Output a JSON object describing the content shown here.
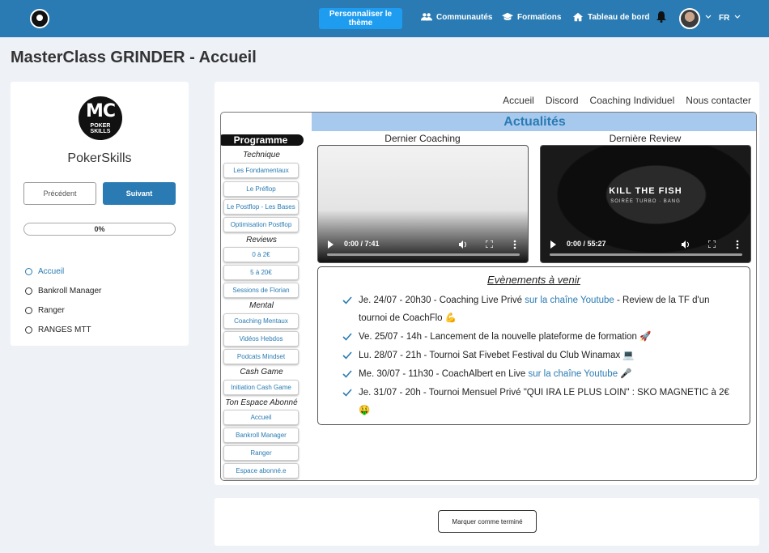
{
  "header": {
    "theme_button": "Personnaliser le thème",
    "nav": [
      {
        "label": "Communautés",
        "icon": "users-icon"
      },
      {
        "label": "Formations",
        "icon": "graduation-cap-icon"
      },
      {
        "label": "Tableau de bord",
        "icon": "home-icon"
      }
    ],
    "language": "FR",
    "brand_color": "#2a7bb3"
  },
  "page_title": "MasterClass GRINDER - Accueil",
  "course": {
    "logo_initials": "MC",
    "logo_line1": "POKER",
    "logo_line2": "SKILLS",
    "name": "PokerSkills",
    "prev_label": "Précédent",
    "next_label": "Suivant",
    "progress_label": "0%",
    "progress_value": 0,
    "lessons": [
      {
        "label": "Accueil",
        "active": true
      },
      {
        "label": "Bankroll Manager",
        "active": false
      },
      {
        "label": "Ranger",
        "active": false
      },
      {
        "label": "RANGES MTT",
        "active": false
      }
    ]
  },
  "main": {
    "top_links": [
      "Accueil",
      "Discord",
      "Coaching Individuel",
      "Nous contacter"
    ],
    "program_title": "Programme",
    "groups": [
      {
        "title": "Technique",
        "items": [
          "Les Fondamentaux",
          "Le Préflop",
          "Le Postflop - Les Bases",
          "Optimisation Postflop"
        ]
      },
      {
        "title": "Reviews",
        "items": [
          "0 à 2€",
          "5 à 20€",
          "Sessions de Florian"
        ]
      },
      {
        "title": "Mental",
        "items": [
          "Coaching Mentaux",
          "Vidéos Hebdos",
          "Podcats Mindset"
        ]
      },
      {
        "title": "Cash Game",
        "items": [
          "Initiation Cash Game"
        ]
      },
      {
        "title": "Ton Espace Abonné",
        "items": [
          "Accueil",
          "Bankroll Manager",
          "Ranger",
          "Espace abonné.e"
        ]
      }
    ],
    "news_title": "Actualités",
    "video1": {
      "label": "Dernier Coaching",
      "time": "0:00 / 7:41"
    },
    "video2": {
      "label": "Dernière Review",
      "time": "0:00 / 55:27",
      "overlay_title": "KILL THE FISH",
      "overlay_sub": "SOIRÉE TURBO · BANG"
    },
    "events_title": "Evènements à venir",
    "events": [
      {
        "before": "Je. 24/07 - 20h30 - Coaching Live Privé ",
        "link": "sur la chaîne Youtube",
        "after": " - Review de la TF d'un tournoi de CoachFlo 💪"
      },
      {
        "before": "Ve. 25/07 - 14h - Lancement de la nouvelle plateforme de formation 🚀",
        "link": "",
        "after": ""
      },
      {
        "before": "Lu. 28/07 - 21h - Tournoi Sat Fivebet Festival du Club Winamax 💻",
        "link": "",
        "after": ""
      },
      {
        "before": "Me. 30/07 - 11h30 - CoachAlbert en Live ",
        "link": "sur la chaîne Youtube",
        "after": " 🎤"
      },
      {
        "before": "Je. 31/07 - 20h - Tournoi Mensuel Privé \"QUI IRA LE PLUS LOIN\" : SKO MAGNETIC à 2€ 🤑",
        "link": "",
        "after": ""
      }
    ],
    "done_button": "Marquer comme terminé"
  }
}
